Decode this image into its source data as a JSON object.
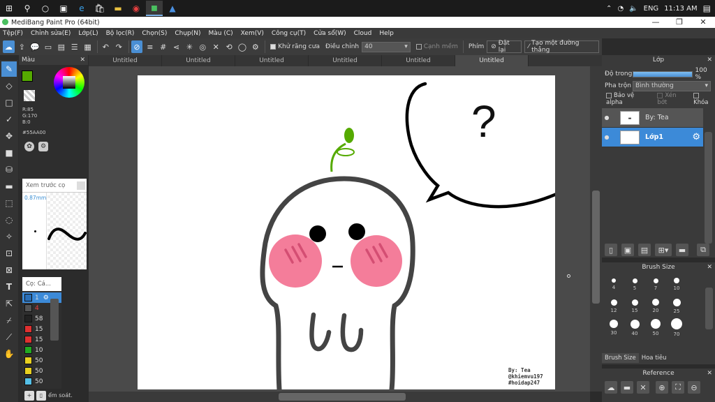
{
  "taskbar": {
    "icons": [
      "windows-icon",
      "search-icon",
      "cortana-icon",
      "task-view-icon",
      "edge-icon",
      "store-icon",
      "explorer-icon",
      "chrome-icon",
      "medibang-icon",
      "photos-icon"
    ],
    "tray": {
      "language": "ENG",
      "time": "11:13 AM"
    }
  },
  "window": {
    "title": "MediBang Paint Pro (64bit)",
    "minimize": "—",
    "maximize": "❐",
    "close": "✕"
  },
  "menu": [
    "Tệp(F)",
    "Chỉnh sửa(E)",
    "Lớp(L)",
    "Bộ lọc(R)",
    "Chọn(S)",
    "Chụp(N)",
    "Màu (C)",
    "Xem(V)",
    "Công cụ(T)",
    "Cửa sổ(W)",
    "Cloud",
    "Help"
  ],
  "toolbar": {
    "antialias_label": "Khử răng cưa",
    "adjust_label": "Điều chỉnh",
    "adjust_value": "40",
    "sharp_edge_label": "Cạnh mềm",
    "key_label": "Phím",
    "reset_label": "Đặt lại",
    "straight_line_label": "Tạo một đường thẳng"
  },
  "color_panel": {
    "title": "Màu",
    "r": "R:85",
    "g": "G:170",
    "b": "B:0",
    "hex": "#55AA00",
    "fg_color": "#55aa00",
    "bg_color": "#ff9966"
  },
  "preview_panel": {
    "title": "Xem trước cọ",
    "size": "0.87mm"
  },
  "palette_panel": {
    "title": "Cọ: Cá...",
    "rows": [
      {
        "color": "#2a6fb8",
        "label": "1"
      },
      {
        "color": "#555555",
        "label": "4"
      },
      {
        "color": "#222222",
        "label": "58"
      },
      {
        "color": "#e03030",
        "label": "15"
      },
      {
        "color": "#e03030",
        "label": "15"
      },
      {
        "color": "#22aa22",
        "label": "10"
      },
      {
        "color": "#e8d020",
        "label": "50"
      },
      {
        "color": "#e8d020",
        "label": "50"
      },
      {
        "color": "#55c0e8",
        "label": "50"
      }
    ],
    "bottom_label": "ểm soát."
  },
  "tabs": [
    "Untitled",
    "Untitled",
    "Untitled",
    "Untitled",
    "Untitled",
    "Untitled"
  ],
  "canvas": {
    "watermark_lines": [
      "By: Tea",
      "@khiemvu197",
      "#hoidap247"
    ],
    "bubble_text": "?"
  },
  "layer_panel": {
    "title": "Lớp",
    "opacity_label": "Độ trong",
    "opacity_value": "100 %",
    "blend_label": "Pha trộn",
    "blend_value": "Bình thường",
    "protect_alpha": "Bảo vệ alpha",
    "clip": "Xén bớt",
    "lock": "Khóa",
    "layers": [
      {
        "name": "By: Tea"
      },
      {
        "name": "Lớp1"
      }
    ]
  },
  "brush_panel": {
    "title": "Brush Size",
    "sizes": [
      "4",
      "5",
      "7",
      "10",
      "12",
      "15",
      "20",
      "25",
      "30",
      "40",
      "50",
      "70"
    ],
    "tab1": "Brush Size",
    "tab2": "Hoa tiêu"
  },
  "reference_panel": {
    "title": "Reference"
  }
}
